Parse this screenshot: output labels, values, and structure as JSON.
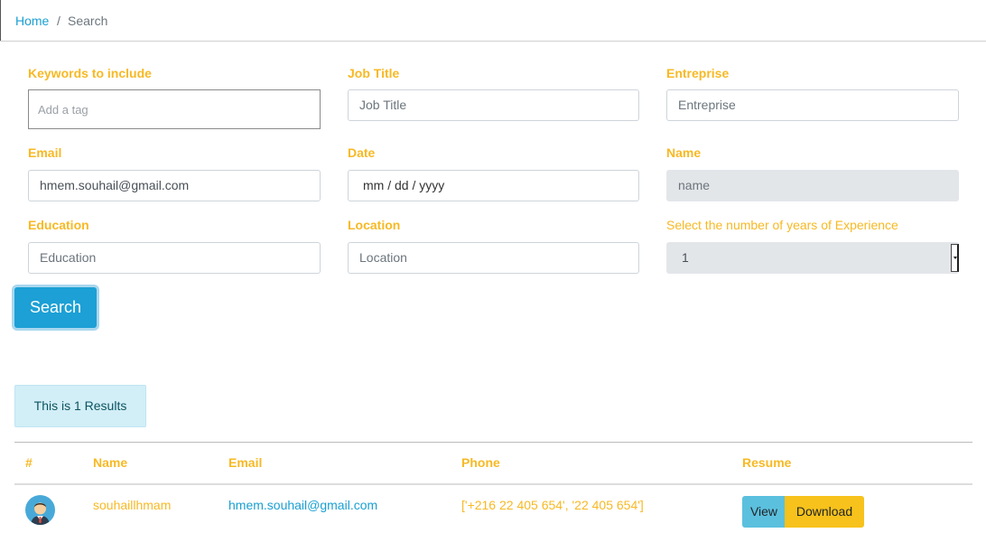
{
  "breadcrumb": {
    "home": "Home",
    "separator": "/",
    "current": "Search"
  },
  "form": {
    "keywords": {
      "label": "Keywords to include",
      "placeholder": "Add a tag"
    },
    "job_title": {
      "label": "Job Title",
      "placeholder": "Job Title"
    },
    "entreprise": {
      "label": "Entreprise",
      "placeholder": "Entreprise"
    },
    "email": {
      "label": "Email",
      "value": "hmem.souhail@gmail.com"
    },
    "date": {
      "label": "Date",
      "placeholder": "mm / dd / yyyy"
    },
    "name": {
      "label": "Name",
      "placeholder": "name"
    },
    "education": {
      "label": "Education",
      "placeholder": "Education"
    },
    "location": {
      "label": "Location",
      "placeholder": "Location"
    },
    "experience": {
      "label": "Select the number of years of Experience",
      "value": "1"
    },
    "search_label": "Search"
  },
  "results": {
    "summary": "This is 1 Results"
  },
  "table": {
    "headers": [
      "#",
      "Name",
      "Email",
      "Phone",
      "Resume"
    ],
    "rows": [
      {
        "name": "souhaillhmam",
        "email": "hmem.souhail@gmail.com",
        "phone": "['+216 22 405 654', '22 405 654']",
        "view_label": "View",
        "download_label": "Download"
      }
    ]
  },
  "colors": {
    "accent": "#f7b924",
    "primary": "#1ca0d5",
    "link": "#1aa0d2"
  }
}
